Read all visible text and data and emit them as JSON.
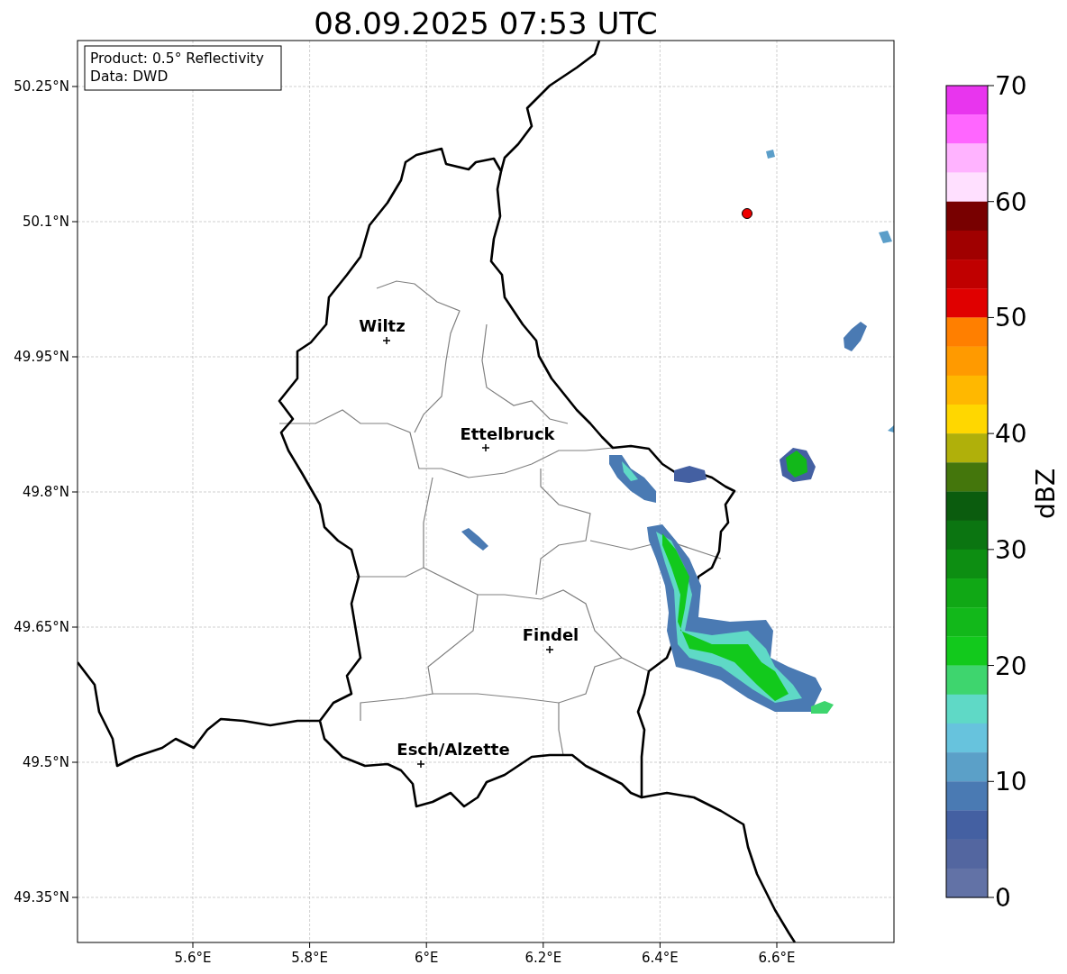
{
  "title": "08.09.2025 07:53 UTC",
  "info_box": [
    "Product: 0.5° Reflectivity",
    "Data: DWD"
  ],
  "map": {
    "lat_ticks": [
      "50.25°N",
      "50.1°N",
      "49.95°N",
      "49.8°N",
      "49.65°N",
      "49.5°N",
      "49.35°N"
    ],
    "lon_ticks": [
      "5.6°E",
      "5.8°E",
      "6°E",
      "6.2°E",
      "6.4°E",
      "6.6°E"
    ],
    "cities": [
      {
        "name": "Wiltz"
      },
      {
        "name": "Ettelbruck"
      },
      {
        "name": "Findel"
      },
      {
        "name": "Esch/Alzette"
      }
    ]
  },
  "colorbar": {
    "label": "dBZ",
    "ticks": [
      "70",
      "60",
      "50",
      "40",
      "30",
      "20",
      "10",
      "0"
    ],
    "bins": [
      {
        "color": "#e835ee"
      },
      {
        "color": "#ff66ff"
      },
      {
        "color": "#ffb3ff"
      },
      {
        "color": "#ffe0ff"
      },
      {
        "color": "#780000"
      },
      {
        "color": "#a00000"
      },
      {
        "color": "#c00000"
      },
      {
        "color": "#e00000"
      },
      {
        "color": "#ff7f00"
      },
      {
        "color": "#ff9a00"
      },
      {
        "color": "#ffb800"
      },
      {
        "color": "#ffd700"
      },
      {
        "color": "#b0b00a"
      },
      {
        "color": "#44760c"
      },
      {
        "color": "#0b5c0e"
      },
      {
        "color": "#0b7511"
      },
      {
        "color": "#0d8e12"
      },
      {
        "color": "#10a815"
      },
      {
        "color": "#12b81a"
      },
      {
        "color": "#12c91c"
      },
      {
        "color": "#3ed56e"
      },
      {
        "color": "#5fd9c6"
      },
      {
        "color": "#67c3dd"
      },
      {
        "color": "#5ba0c8"
      },
      {
        "color": "#4a7ab3"
      },
      {
        "color": "#4460a2"
      },
      {
        "color": "#5366a0"
      },
      {
        "color": "#6272a6"
      }
    ]
  }
}
